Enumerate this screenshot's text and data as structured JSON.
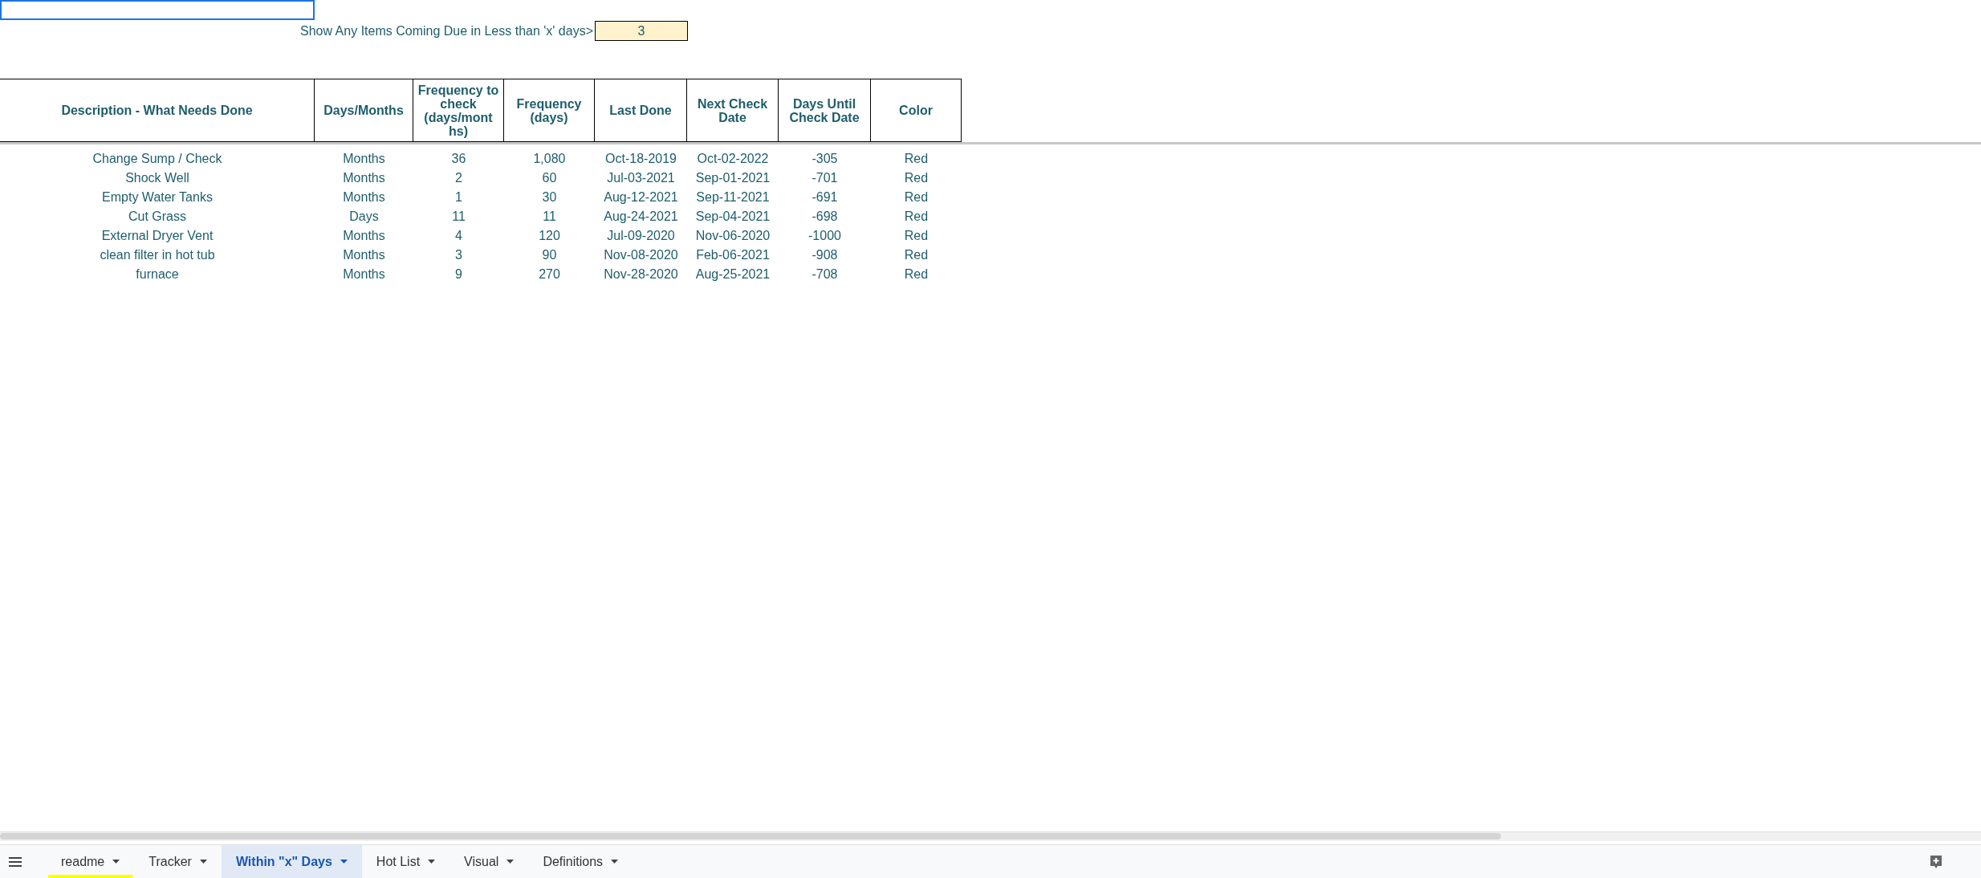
{
  "filter": {
    "label": "Show Any Items Coming Due in Less than 'x' days>",
    "value": "3"
  },
  "table": {
    "columns": [
      "Description - What Needs Done",
      "Days/Months",
      "Frequency to check (days/mont hs)",
      "Frequency (days)",
      "Last Done",
      "Next Check Date",
      "Days Until Check Date",
      "Color"
    ],
    "rows": [
      [
        "Change Sump / Check",
        "Months",
        "36",
        "1,080",
        "Oct-18-2019",
        "Oct-02-2022",
        "-305",
        "Red"
      ],
      [
        "Shock Well",
        "Months",
        "2",
        "60",
        "Jul-03-2021",
        "Sep-01-2021",
        "-701",
        "Red"
      ],
      [
        "Empty Water Tanks",
        "Months",
        "1",
        "30",
        "Aug-12-2021",
        "Sep-11-2021",
        "-691",
        "Red"
      ],
      [
        "Cut Grass",
        "Days",
        "11",
        "11",
        "Aug-24-2021",
        "Sep-04-2021",
        "-698",
        "Red"
      ],
      [
        "External Dryer Vent",
        "Months",
        "4",
        "120",
        "Jul-09-2020",
        "Nov-06-2020",
        "-1000",
        "Red"
      ],
      [
        "clean filter in hot tub",
        "Months",
        "3",
        "90",
        "Nov-08-2020",
        "Feb-06-2021",
        "-908",
        "Red"
      ],
      [
        "furnace",
        "Months",
        "9",
        "270",
        "Nov-28-2020",
        "Aug-25-2021",
        "-708",
        "Red"
      ]
    ]
  },
  "sheet_tabs": [
    {
      "label": "readme",
      "selected": false,
      "color": "#ffff00"
    },
    {
      "label": "Tracker",
      "selected": false
    },
    {
      "label": "Within \"x\" Days",
      "selected": true
    },
    {
      "label": "Hot List",
      "selected": false
    },
    {
      "label": "Visual",
      "selected": false
    },
    {
      "label": "Definitions",
      "selected": false
    }
  ]
}
